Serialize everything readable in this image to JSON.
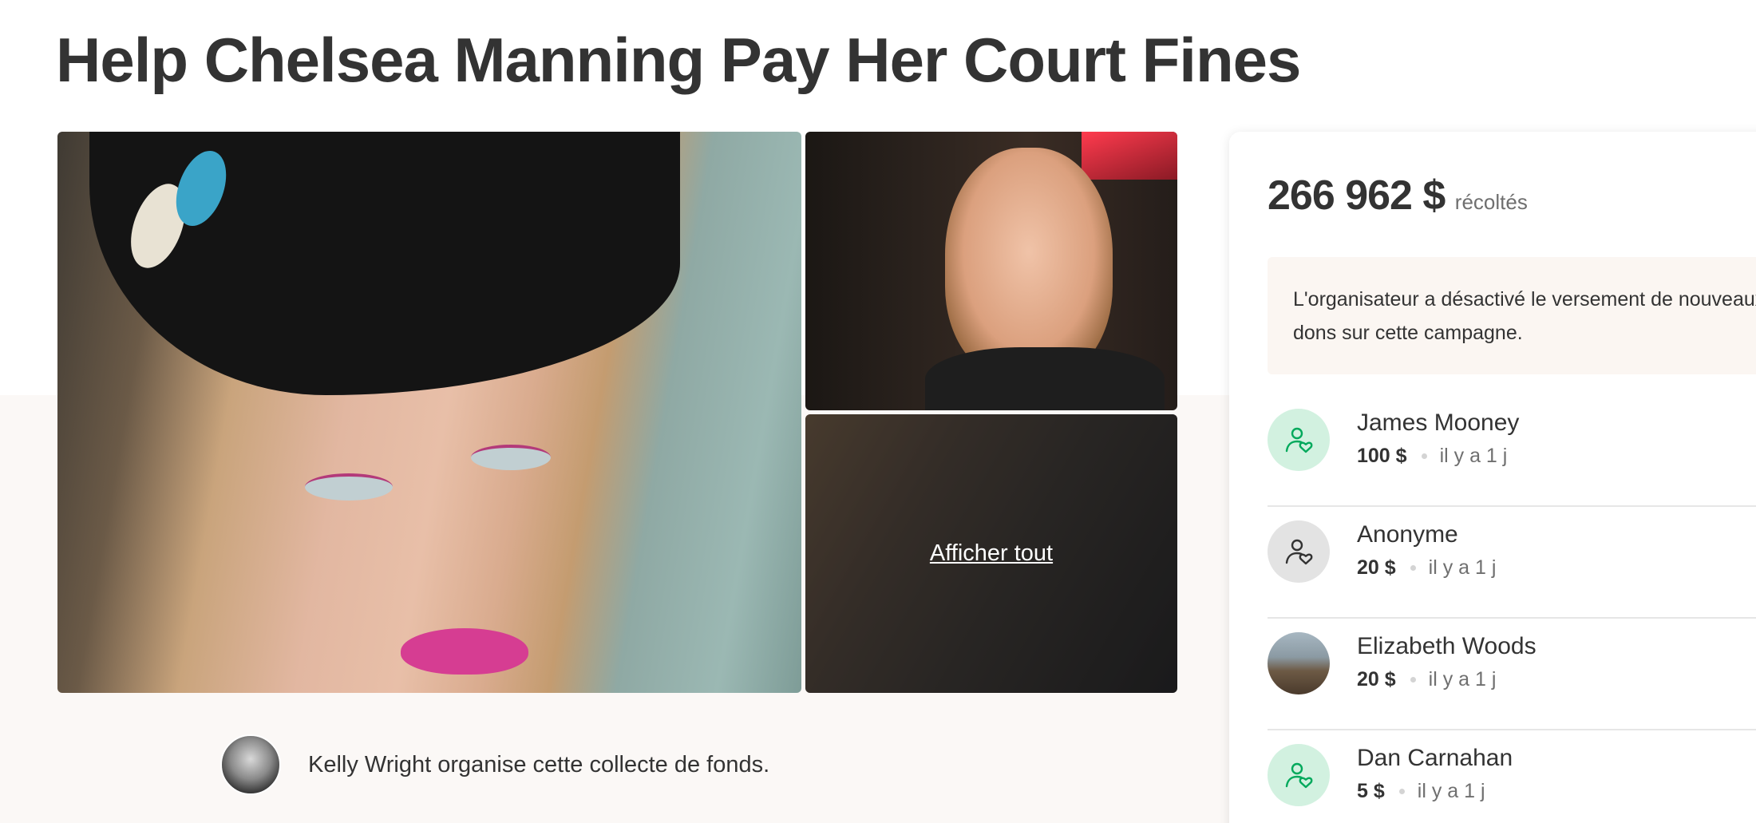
{
  "campaign": {
    "title": "Help Chelsea Manning Pay Her Court Fines"
  },
  "gallery": {
    "show_all_label": "Afficher tout"
  },
  "organizer": {
    "text": "Kelly Wright organise cette collecte de fonds."
  },
  "donation_card": {
    "amount_raised": "266 962 $",
    "raised_label": "récoltés",
    "notice": "L'organisateur a désactivé le versement de nouveaux dons sur cette campagne.",
    "donations": [
      {
        "name": "James Mooney",
        "amount": "100 $",
        "time": "il y a 1 j",
        "avatar": "heart-user-icon-green"
      },
      {
        "name": "Anonyme",
        "amount": "20 $",
        "time": "il y a 1 j",
        "avatar": "heart-user-icon-grey"
      },
      {
        "name": "Elizabeth Woods",
        "amount": "20 $",
        "time": "il y a 1 j",
        "avatar": "photo"
      },
      {
        "name": "Dan Carnahan",
        "amount": "5 $",
        "time": "il y a 1 j",
        "avatar": "heart-user-icon-green"
      }
    ]
  },
  "colors": {
    "title_text": "#333333",
    "band_background": "#fbf8f6",
    "notice_background": "#fbf6f2",
    "donor_avatar_green": "#d2f1e0",
    "donor_icon_green": "#02a95c",
    "donor_avatar_grey": "#e3e3e3"
  }
}
